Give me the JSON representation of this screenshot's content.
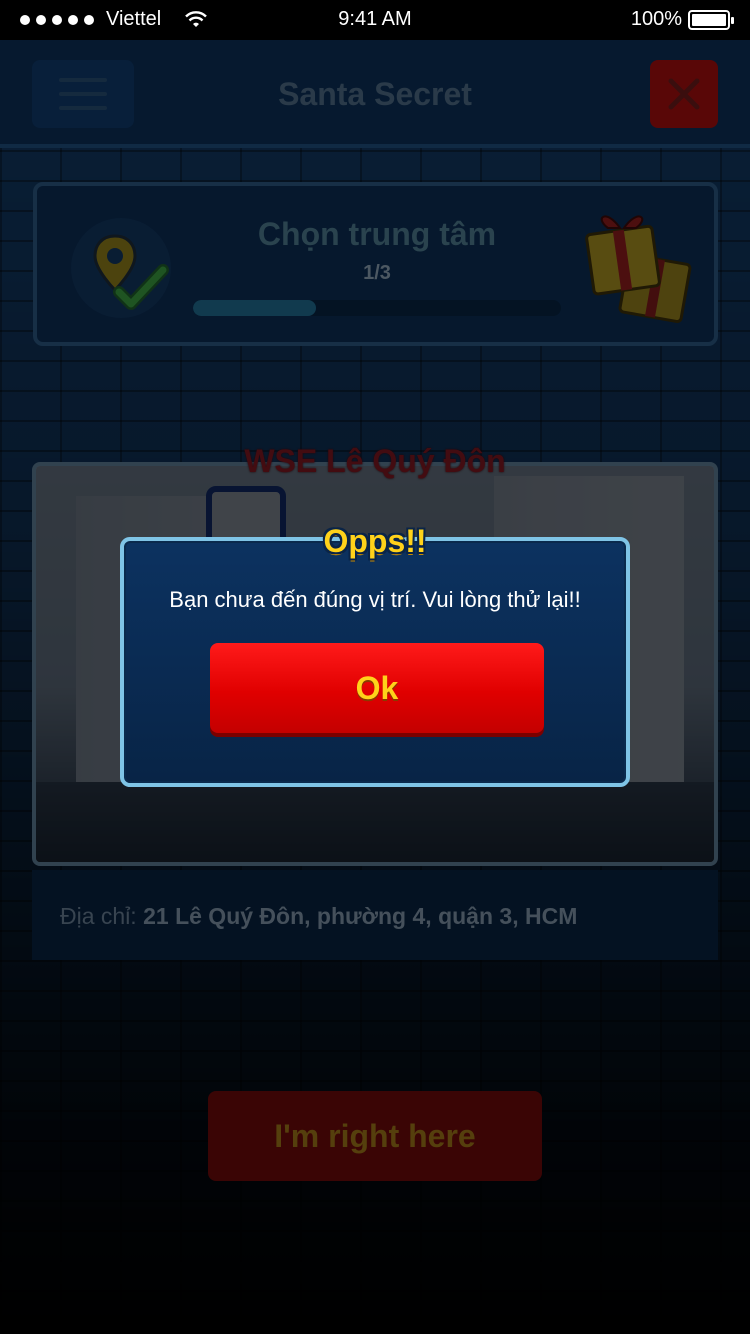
{
  "status_bar": {
    "carrier": "Viettel",
    "time": "9:41 AM",
    "battery": "100%"
  },
  "header": {
    "title": "Santa Secret",
    "menu_icon": "hamburger-icon",
    "close_icon": "close-icon"
  },
  "progress": {
    "title": "Chọn trung tâm",
    "count": "1/3",
    "fraction": 0.333,
    "badge_icon": "location-check-icon",
    "reward_icon": "gift-icon"
  },
  "center": {
    "name": "WSE Lê Quý Đôn",
    "address_label": "Địa chỉ:",
    "address_value": "21 Lê Quý Đôn, phường 4, quận 3, HCM"
  },
  "here_button_label": "I'm right here",
  "modal": {
    "title": "Opps!!",
    "message": "Bạn chưa đến đúng vị trí. Vui lòng thử lại!!",
    "ok_label": "Ok"
  },
  "colors": {
    "accent_red": "#e00000",
    "accent_yellow": "#ffd21a",
    "modal_border": "#7fc4e6",
    "background": "#123a66"
  }
}
